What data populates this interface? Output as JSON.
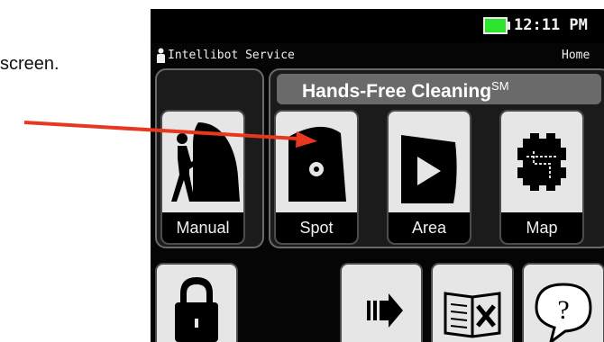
{
  "page_text": "screen.",
  "status_bar": {
    "time": "12:11 PM",
    "battery_color": "#2ee42e"
  },
  "header": {
    "user": "Intellibot Service",
    "home": "Home"
  },
  "section": {
    "title": "Hands-Free Cleaning",
    "mark": "SM"
  },
  "modes": [
    {
      "label": "Manual",
      "icon": "manual-operator-icon"
    },
    {
      "label": "Spot",
      "icon": "spot-cleaning-icon"
    },
    {
      "label": "Area",
      "icon": "area-cleaning-icon"
    },
    {
      "label": "Map",
      "icon": "map-cleaning-icon"
    }
  ],
  "bottom_buttons": [
    {
      "icon": "lock-icon"
    },
    {
      "icon": "next-arrow-icon"
    },
    {
      "icon": "manual-tools-icon"
    },
    {
      "icon": "help-icon"
    }
  ],
  "annotation": {
    "arrow_color": "#e8361f",
    "points_to": "Spot"
  }
}
